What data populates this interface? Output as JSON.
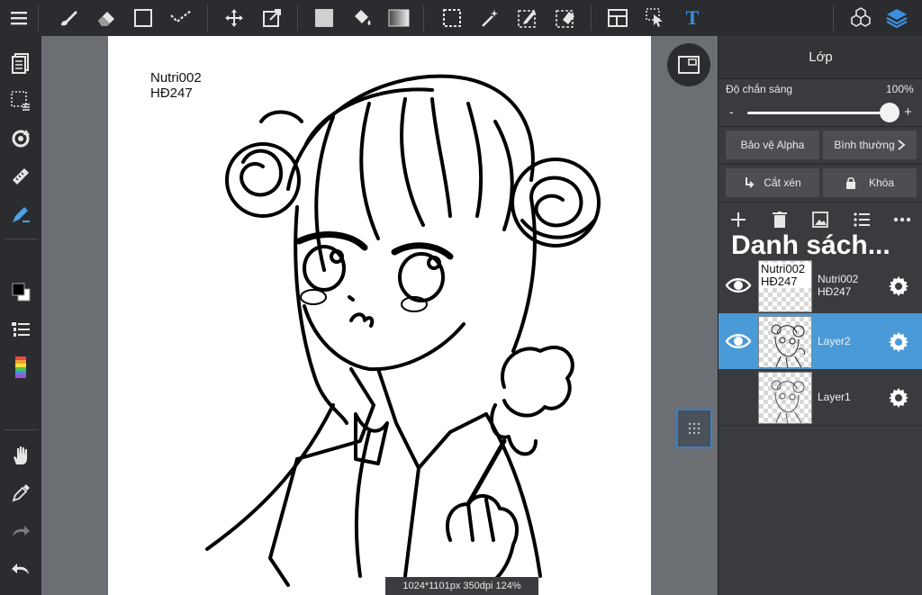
{
  "toolbar": {
    "icons": [
      "menu-icon",
      "brush-icon",
      "eraser-icon",
      "rectangle-icon",
      "line-icon",
      "move-icon",
      "transform-icon",
      "fill-color-icon",
      "bucket-icon",
      "gradient-icon",
      "select-rect-icon",
      "magic-wand-icon",
      "select-pen-icon",
      "select-eraser-icon",
      "layout-icon",
      "operation-icon",
      "text-icon",
      "material-icon",
      "layers-icon"
    ],
    "text_tool_glyph": "T"
  },
  "left_tools": [
    "page-icon",
    "selection-icon",
    "rotate-icon",
    "ruler-icon",
    "pen-icon",
    "color-swatch-icon",
    "brush-list-icon",
    "palette-icon",
    "hand-icon",
    "eyedropper-icon",
    "redo-icon",
    "undo-icon"
  ],
  "canvas": {
    "text_line1": "Nutri002",
    "text_line2": "HĐ247",
    "status": "1024*1101px 350dpi 124%"
  },
  "panel": {
    "title": "Lớp",
    "opacity_label": "Độ chắn sáng",
    "opacity_value": "100%",
    "opacity_minus": "-",
    "opacity_plus": "+",
    "opacity_fraction": 1.0,
    "alpha_protect": "Bảo vệ Alpha",
    "blend_mode": "Bình thường",
    "clip": "Cắt xén",
    "lock": "Khóa",
    "list_title": "Danh sách...",
    "layers": [
      {
        "name_line1": "Nutri002",
        "name_line2": "HĐ247",
        "visible": true,
        "selected": false,
        "thumb_text1": "Nutri002",
        "thumb_text2": "HĐ247"
      },
      {
        "name_line1": "Layer2",
        "name_line2": "",
        "visible": true,
        "selected": true
      },
      {
        "name_line1": "Layer1",
        "name_line2": "",
        "visible": false,
        "selected": false
      }
    ]
  },
  "colors": {
    "accent": "#4a9ad8",
    "text_tool": "#3a8fe0"
  }
}
